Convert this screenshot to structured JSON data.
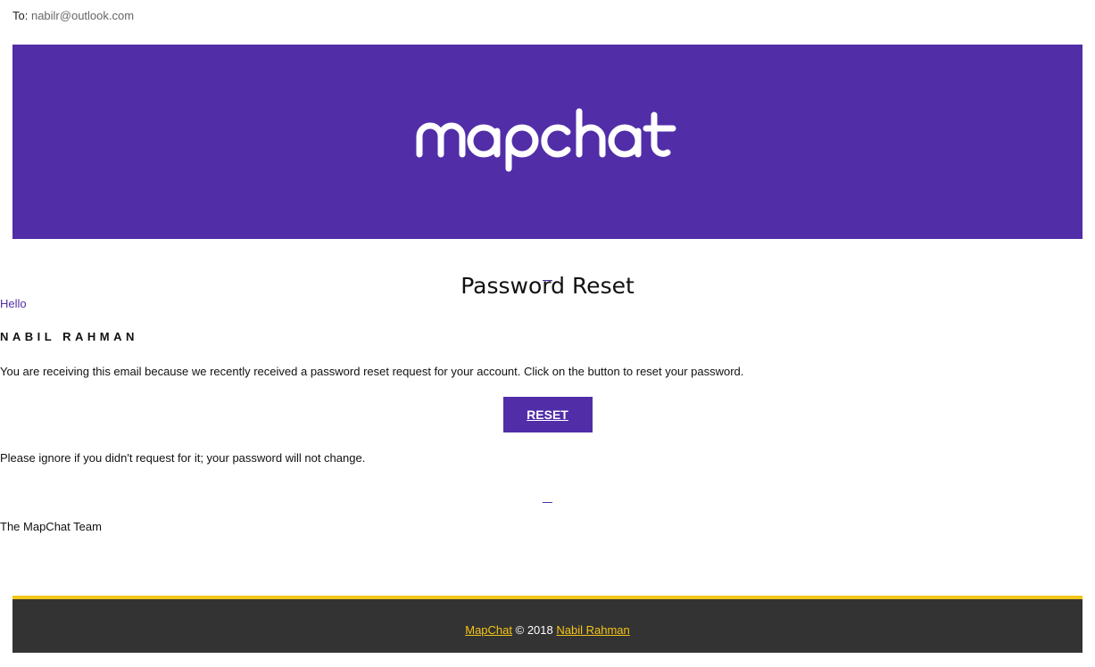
{
  "header": {
    "to_label": "To:",
    "to_address": "nabilr@outlook.com"
  },
  "banner": {
    "logo_text": "mapchat",
    "background_color": "#512da8"
  },
  "content": {
    "title": "Password Reset",
    "greeting": "Hello",
    "recipient_name": "NABIL RAHMAN",
    "message": "You are receiving this email because we recently received a password reset request for your account. Click on the button to reset your password.",
    "reset_button_label": "RESET",
    "ignore_note": "Please ignore if you didn't request for it; your password will not change.",
    "signature": "The MapChat Team"
  },
  "footer": {
    "brand_link": "MapChat",
    "copyright": "© 2018",
    "author_link": "Nabil Rahman",
    "accent_color": "#f5c518",
    "background_color": "#333333"
  }
}
